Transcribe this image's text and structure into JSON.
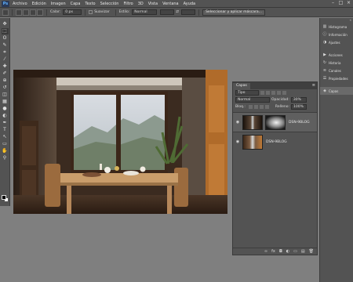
{
  "menubar": {
    "logo": "Ps",
    "items": [
      "Archivo",
      "Edición",
      "Imagen",
      "Capa",
      "Texto",
      "Selección",
      "Filtro",
      "3D",
      "Vista",
      "Ventana",
      "Ayuda"
    ],
    "controls": [
      "–",
      "□",
      "×"
    ]
  },
  "options": {
    "feather_label": "Calar:",
    "feather_value": "0 px",
    "antialias_label": "Suavizar",
    "style_label": "Estilo:",
    "style_value": "Normal",
    "refine_button": "Seleccionar y aplicar máscara..."
  },
  "toolbar": {
    "tools": [
      "move-tool",
      "marquee-tool",
      "lasso-tool",
      "quick-selection-tool",
      "crop-tool",
      "eyedropper-tool",
      "healing-brush-tool",
      "brush-tool",
      "clone-stamp-tool",
      "history-brush-tool",
      "eraser-tool",
      "gradient-tool",
      "blur-tool",
      "dodge-tool",
      "pen-tool",
      "type-tool",
      "path-selection-tool",
      "rectangle-tool",
      "hand-tool",
      "zoom-tool"
    ],
    "glyphs": [
      "✥",
      "⬚",
      "ʘ",
      "✎",
      "⌗",
      "⁄",
      "✚",
      "✐",
      "⊕",
      "↺",
      "◫",
      "▦",
      "●",
      "◐",
      "✒",
      "T",
      "↖",
      "▭",
      "✋",
      "⚲"
    ],
    "foreground_color": "#000000",
    "background_color": "#ffffff"
  },
  "dock": {
    "group1": [
      {
        "icon": "histogram-icon",
        "glyph": "▥",
        "label": "Histograma"
      },
      {
        "icon": "info-icon",
        "glyph": "ⓘ",
        "label": "Información"
      },
      {
        "icon": "adjustments-icon",
        "glyph": "◑",
        "label": "Ajustes"
      }
    ],
    "group2": [
      {
        "icon": "actions-icon",
        "glyph": "▶",
        "label": "Acciones"
      },
      {
        "icon": "history-icon",
        "glyph": "↻",
        "label": "Historia"
      },
      {
        "icon": "channels-icon",
        "glyph": "≋",
        "label": "Canales"
      },
      {
        "icon": "properties-icon",
        "glyph": "☰",
        "label": "Propiedades"
      }
    ],
    "group3": [
      {
        "icon": "layers-icon",
        "glyph": "◈",
        "label": "Capas"
      }
    ]
  },
  "layers": {
    "tab": "Capas",
    "filter_label": "Tipo",
    "blend_mode": "Normal",
    "opacity_label": "Opacidad:",
    "opacity_value": "30%",
    "lock_label": "Bloq.:",
    "fill_label": "Relleno:",
    "fill_value": "100%",
    "items": [
      {
        "name": "DSN-9BLOG",
        "has_mask": true,
        "selected": true
      },
      {
        "name": "DSN-9BLOG",
        "has_mask": false,
        "selected": false
      }
    ],
    "footer_icons": [
      "∞",
      "fx",
      "◘",
      "◐",
      "▭",
      "▤",
      "🗑"
    ]
  }
}
